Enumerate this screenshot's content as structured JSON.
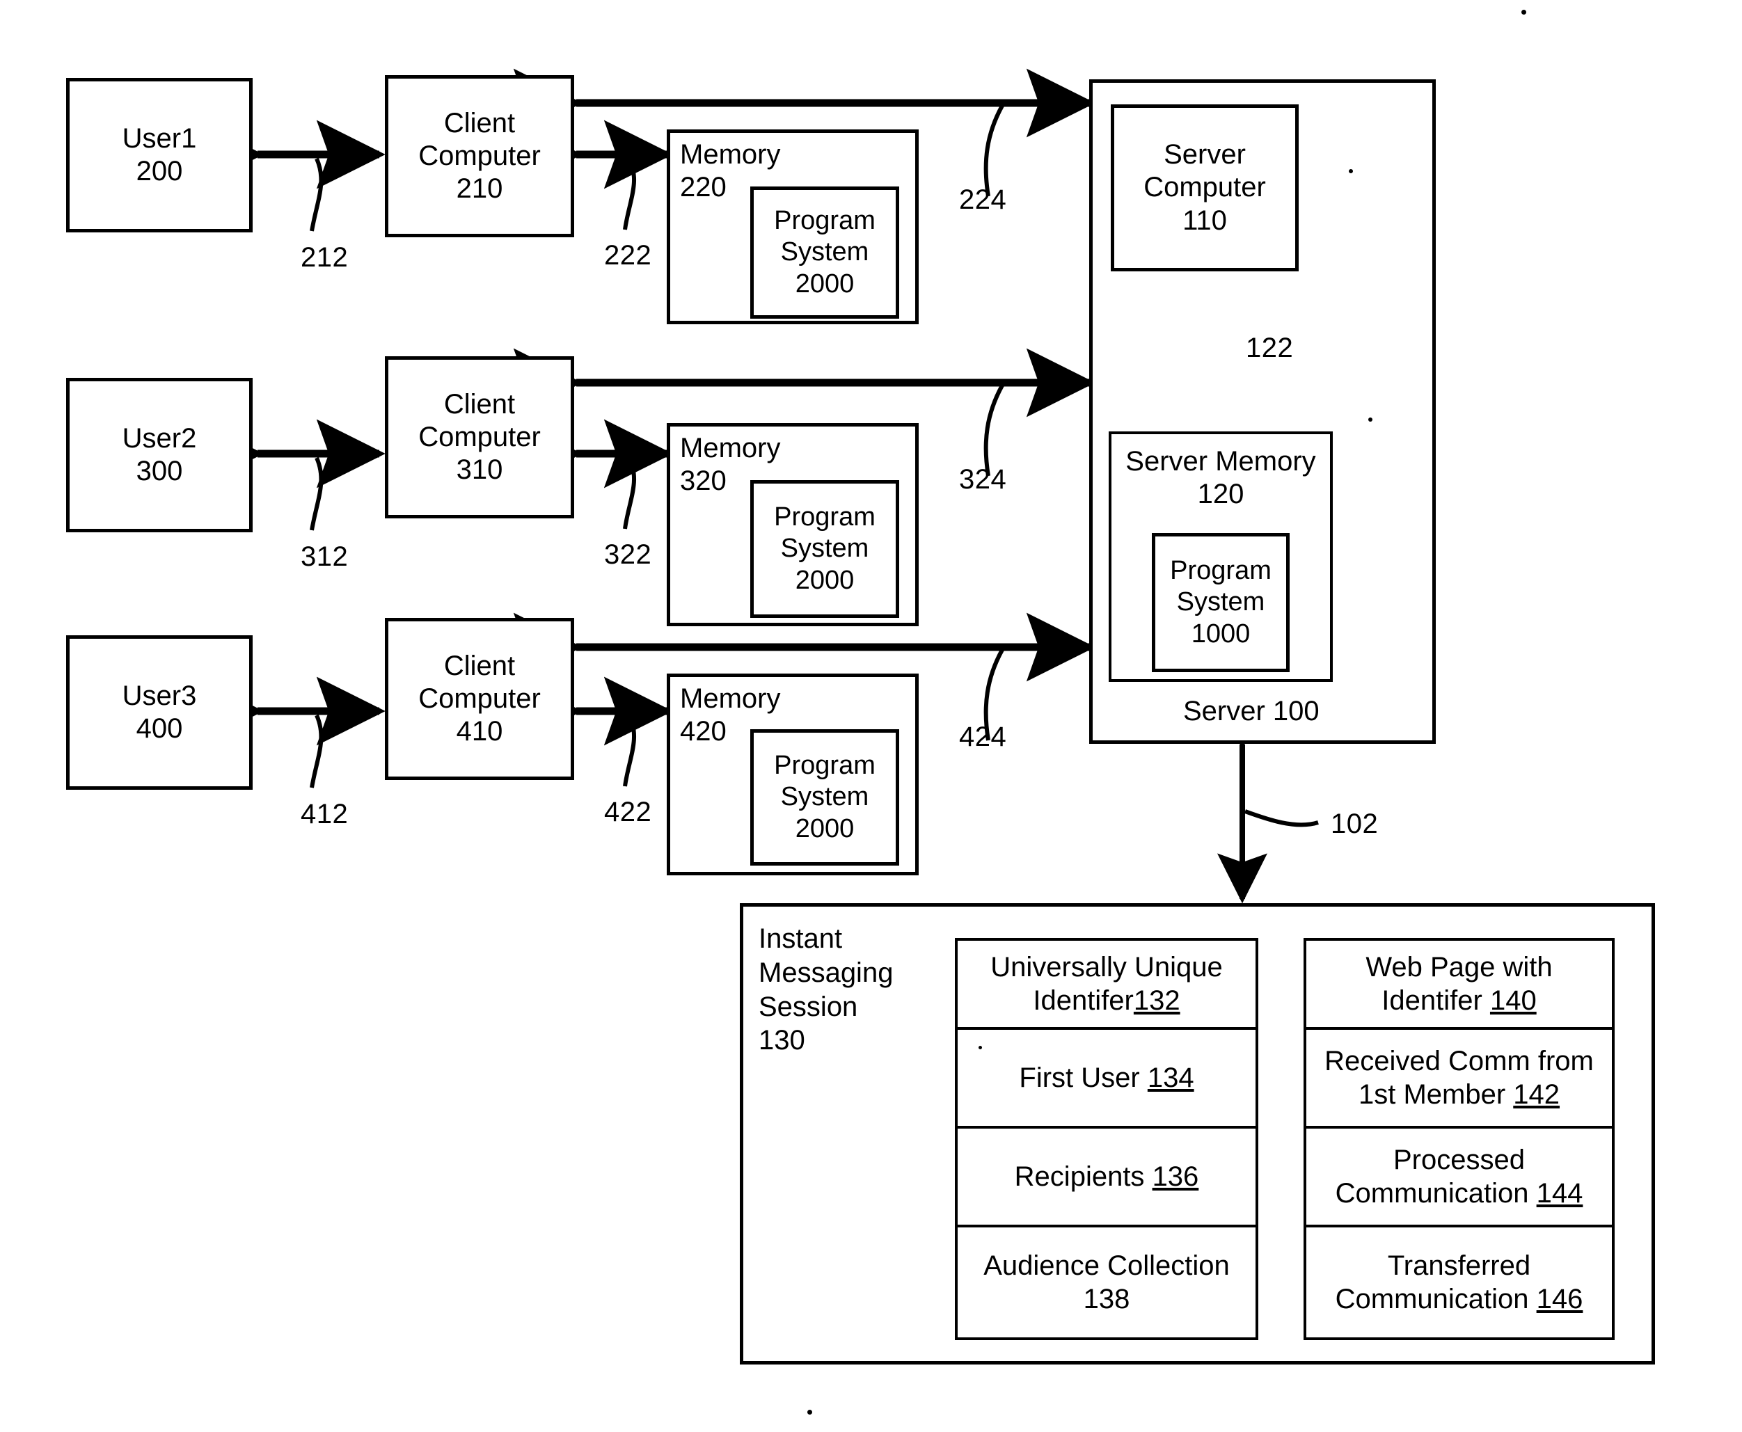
{
  "figure": {
    "rows": [
      {
        "user": {
          "name": "User1",
          "num": "200"
        },
        "client": {
          "name_line1": "Client",
          "name_line2": "Computer",
          "num": "210"
        },
        "memory": {
          "name": "Memory",
          "num": "220"
        },
        "program": {
          "line1": "Program",
          "line2": "System",
          "num": "2000"
        },
        "ref_user_link": "212",
        "ref_mem_link": "222",
        "ref_net_link": "224"
      },
      {
        "user": {
          "name": "User2",
          "num": "300"
        },
        "client": {
          "name_line1": "Client",
          "name_line2": "Computer",
          "num": "310"
        },
        "memory": {
          "name": "Memory",
          "num": "320"
        },
        "program": {
          "line1": "Program",
          "line2": "System",
          "num": "2000"
        },
        "ref_user_link": "312",
        "ref_mem_link": "322",
        "ref_net_link": "324"
      },
      {
        "user": {
          "name": "User3",
          "num": "400"
        },
        "client": {
          "name_line1": "Client",
          "name_line2": "Computer",
          "num": "410"
        },
        "memory": {
          "name": "Memory",
          "num": "420"
        },
        "program": {
          "line1": "Program",
          "line2": "System",
          "num": "2000"
        },
        "ref_user_link": "412",
        "ref_mem_link": "422",
        "ref_net_link": "424"
      }
    ],
    "server": {
      "caption": "Server 100",
      "computer": {
        "line1": "Server",
        "line2": "Computer",
        "num": "110"
      },
      "memory": {
        "line1": "Server Memory",
        "num": "120"
      },
      "program": {
        "line1": "Program",
        "line2": "System",
        "num": "1000"
      },
      "ref_internal_link": "122",
      "ref_session_link": "102"
    },
    "im_session": {
      "title_line1": "Instant",
      "title_line2": "Messaging",
      "title_line3": "Session",
      "title_num": "130",
      "left_column": [
        {
          "text": "Universally Unique",
          "text2": "Identifer",
          "num": "132",
          "num_underlined": true,
          "tight": true
        },
        {
          "text": "First User",
          "num": "134",
          "num_underlined": true
        },
        {
          "text": "Recipients",
          "num": "136",
          "num_underlined": true
        },
        {
          "text": "Audience Collection",
          "num": "138",
          "num_underlined": false,
          "stacked": true
        }
      ],
      "right_column": [
        {
          "text": "Web Page with",
          "text2": "Identifer",
          "num": "140",
          "num_underlined": true
        },
        {
          "text": "Received Comm from",
          "text2": "1st Member",
          "num": "142",
          "num_underlined": true
        },
        {
          "text": "Processed",
          "text2": "Communication",
          "num": "144",
          "num_underlined": true
        },
        {
          "text": "Transferred",
          "text2": "Communication",
          "num": "146",
          "num_underlined": true
        }
      ]
    },
    "colors": {
      "ink": "#000000",
      "paper": "#ffffff"
    }
  }
}
